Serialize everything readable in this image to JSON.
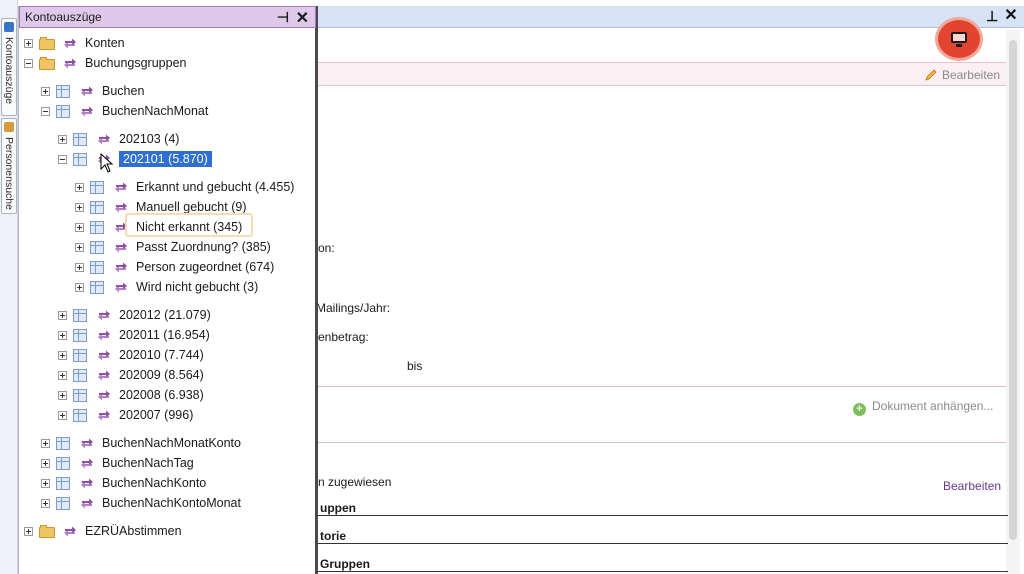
{
  "left_strip": {
    "tabs": [
      {
        "label": "Kontoauszüge",
        "icon": "window-blue-icon"
      },
      {
        "label": "Personensuche",
        "icon": "person-search-icon"
      }
    ]
  },
  "tree_panel": {
    "title": "Kontoauszüge",
    "pin_icon": "pin-icon",
    "close_icon": "close-icon",
    "nodes": [
      {
        "label": "Konten"
      },
      {
        "label": "Buchungsgruppen"
      },
      {
        "label": "Buchen"
      },
      {
        "label": "BuchenNachMonat"
      },
      {
        "label": "202103 (4)"
      },
      {
        "label": "202101 (5.870)"
      },
      {
        "label": "Erkannt und gebucht (4.455)"
      },
      {
        "label": "Manuell gebucht (9)"
      },
      {
        "label": "Nicht erkannt (345)"
      },
      {
        "label": "Passt Zuordnung? (385)"
      },
      {
        "label": "Person zugeordnet (674)"
      },
      {
        "label": "Wird nicht gebucht (3)"
      },
      {
        "label": "202012 (21.079)"
      },
      {
        "label": "202011 (16.954)"
      },
      {
        "label": "202010 (7.744)"
      },
      {
        "label": "202009 (8.564)"
      },
      {
        "label": "202008 (6.938)"
      },
      {
        "label": "202007 (996)"
      },
      {
        "label": "BuchenNachMonatKonto"
      },
      {
        "label": "BuchenNachTag"
      },
      {
        "label": "BuchenNachKonto"
      },
      {
        "label": "BuchenNachKontoMonat"
      },
      {
        "label": "EZRÜAbstimmen"
      }
    ]
  },
  "main": {
    "bearbeiten_top": "Bearbeiten",
    "fragments": {
      "on": "on:",
      "mailings": "Mailings/Jahr:",
      "enbetrag": "enbetrag:",
      "bis": "bis",
      "zugewiesen": "n zugewiesen",
      "uppen": "uppen",
      "torie": "torie",
      "gruppen": "Gruppen"
    },
    "document_attach": "Dokument anhängen...",
    "bearbeiten_link": "Bearbeiten"
  },
  "colors": {
    "selection": "#2f6fd1",
    "tree_title_bg": "#dec9ea",
    "highlight_border": "#f6dcb6",
    "screen_button": "#e14530",
    "link_purple": "#6a3a8e"
  }
}
